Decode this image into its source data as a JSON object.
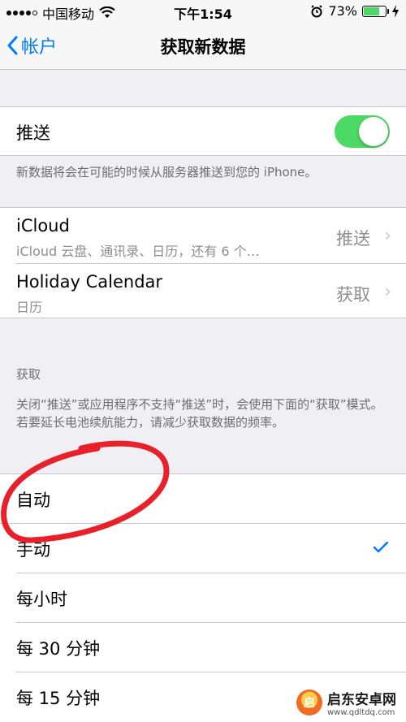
{
  "status_bar": {
    "carrier": "中国移动",
    "time": "下午1:54",
    "battery_percent": "73%",
    "battery_level": 0.73,
    "icons": [
      "signal-icon",
      "wifi-icon",
      "alarm-icon",
      "battery-icon",
      "charging-icon"
    ]
  },
  "nav": {
    "back_label": "帐户",
    "title": "获取新数据"
  },
  "push": {
    "label": "推送",
    "enabled": true,
    "footer": "新数据将会在可能的时候从服务器推送到您的 iPhone。"
  },
  "accounts": [
    {
      "name": "iCloud",
      "detail": "iCloud 云盘、通讯录、日历，还有 6 个…",
      "value": "推送"
    },
    {
      "name": "Holiday Calendar",
      "detail": "日历",
      "value": "获取"
    }
  ],
  "fetch": {
    "header": "获取",
    "description": "关闭“推送”或应用程序不支持“推送”时，会使用下面的“获取”模式。若要延长电池续航能力，请减少获取数据的频率。",
    "options": [
      {
        "label": "自动",
        "selected": false
      },
      {
        "label": "手动",
        "selected": true
      },
      {
        "label": "每小时",
        "selected": false
      },
      {
        "label": "每 30 分钟",
        "selected": false
      },
      {
        "label": "每 15 分钟",
        "selected": false
      }
    ]
  },
  "watermark": {
    "title": "启东安卓网",
    "url": "www.qdltdq.com"
  },
  "colors": {
    "accent": "#007aff",
    "toggle_on": "#4cd964",
    "annotation": "#e8202a"
  }
}
